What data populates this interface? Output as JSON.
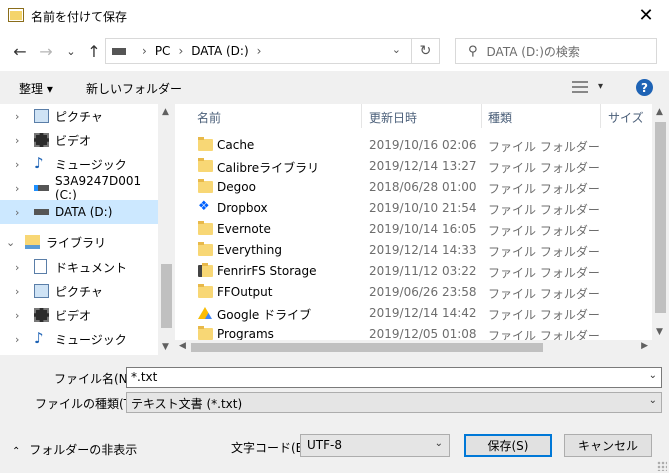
{
  "window": {
    "title": "名前を付けて保存",
    "close_glyph": "✕"
  },
  "navigation": {
    "back_glyph": "←",
    "forward_glyph": "→",
    "recent_glyph": "⌄",
    "up_glyph": "↑",
    "path": [
      "PC",
      "DATA (D:)"
    ],
    "path_sep": "›",
    "dropdown_glyph": "⌄",
    "refresh_glyph": "↻",
    "search_placeholder": "DATA (D:)の検索",
    "search_glyph": "⚲"
  },
  "toolbar": {
    "organize": "整理 ▾",
    "new_folder": "新しいフォルダー",
    "view_dropdown": "▾",
    "help": "?"
  },
  "sidebar": {
    "items": [
      {
        "label": "ピクチャ",
        "icon": "pictures-icon",
        "expand": "›",
        "selected": false
      },
      {
        "label": "ビデオ",
        "icon": "video-icon",
        "expand": "›",
        "selected": false
      },
      {
        "label": "ミュージック",
        "icon": "music-icon",
        "expand": "›",
        "selected": false
      },
      {
        "label": "S3A9247D001 (C:)",
        "icon": "system-drive-icon",
        "expand": "›",
        "selected": false
      },
      {
        "label": "DATA (D:)",
        "icon": "drive-icon",
        "expand": "›",
        "selected": true
      },
      {
        "label": "ライブラリ",
        "icon": "library-icon",
        "expand": "⌄",
        "selected": false
      },
      {
        "label": "ドキュメント",
        "icon": "documents-icon",
        "expand": "›",
        "selected": false
      },
      {
        "label": "ピクチャ",
        "icon": "pictures-icon",
        "expand": "›",
        "selected": false
      },
      {
        "label": "ビデオ",
        "icon": "video-icon",
        "expand": "›",
        "selected": false
      },
      {
        "label": "ミュージック",
        "icon": "music-icon",
        "expand": "›",
        "selected": false
      }
    ]
  },
  "filelist": {
    "columns": {
      "name": "名前",
      "date": "更新日時",
      "type": "種類",
      "size": "サイズ"
    },
    "sort_glyph": "^",
    "rows": [
      {
        "name": "Cache",
        "date": "2019/10/16 02:06",
        "type": "ファイル フォルダー",
        "icon": "folder-icon"
      },
      {
        "name": "Calibreライブラリ",
        "date": "2019/12/14 13:27",
        "type": "ファイル フォルダー",
        "icon": "folder-icon"
      },
      {
        "name": "Degoo",
        "date": "2018/06/28 01:00",
        "type": "ファイル フォルダー",
        "icon": "folder-icon"
      },
      {
        "name": "Dropbox",
        "date": "2019/10/10 21:54",
        "type": "ファイル フォルダー",
        "icon": "dropbox-icon"
      },
      {
        "name": "Evernote",
        "date": "2019/10/14 16:05",
        "type": "ファイル フォルダー",
        "icon": "folder-icon"
      },
      {
        "name": "Everything",
        "date": "2019/12/14 14:33",
        "type": "ファイル フォルダー",
        "icon": "folder-icon"
      },
      {
        "name": "FenrirFS Storage",
        "date": "2019/11/12 03:22",
        "type": "ファイル フォルダー",
        "icon": "fenrir-folder-icon"
      },
      {
        "name": "FFOutput",
        "date": "2019/06/26 23:58",
        "type": "ファイル フォルダー",
        "icon": "folder-icon"
      },
      {
        "name": "Google ドライブ",
        "date": "2019/12/14 14:42",
        "type": "ファイル フォルダー",
        "icon": "google-drive-icon"
      },
      {
        "name": "Programs",
        "date": "2019/12/05 01:08",
        "type": "ファイル フォルダー",
        "icon": "folder-icon"
      }
    ]
  },
  "scrollbars": {
    "up": "▲",
    "down": "▼",
    "left": "◀",
    "right": "▶"
  },
  "form": {
    "filename_label": "ファイル名(N):",
    "filename_value": "*.txt",
    "filetype_label": "ファイルの種類(T):",
    "filetype_value": "テキスト文書 (*.txt)",
    "dropdown_glyph": "⌄",
    "hide_folders_caret": "⌃",
    "hide_folders": "フォルダーの非表示",
    "encoding_label": "文字コード(E):",
    "encoding_value": "UTF-8",
    "save_button": "保存(S)",
    "cancel_button": "キャンセル"
  },
  "colors": {
    "selection": "#cce8ff",
    "accent": "#0078d7",
    "folder": "#f8d775",
    "help": "#1e63b5"
  }
}
